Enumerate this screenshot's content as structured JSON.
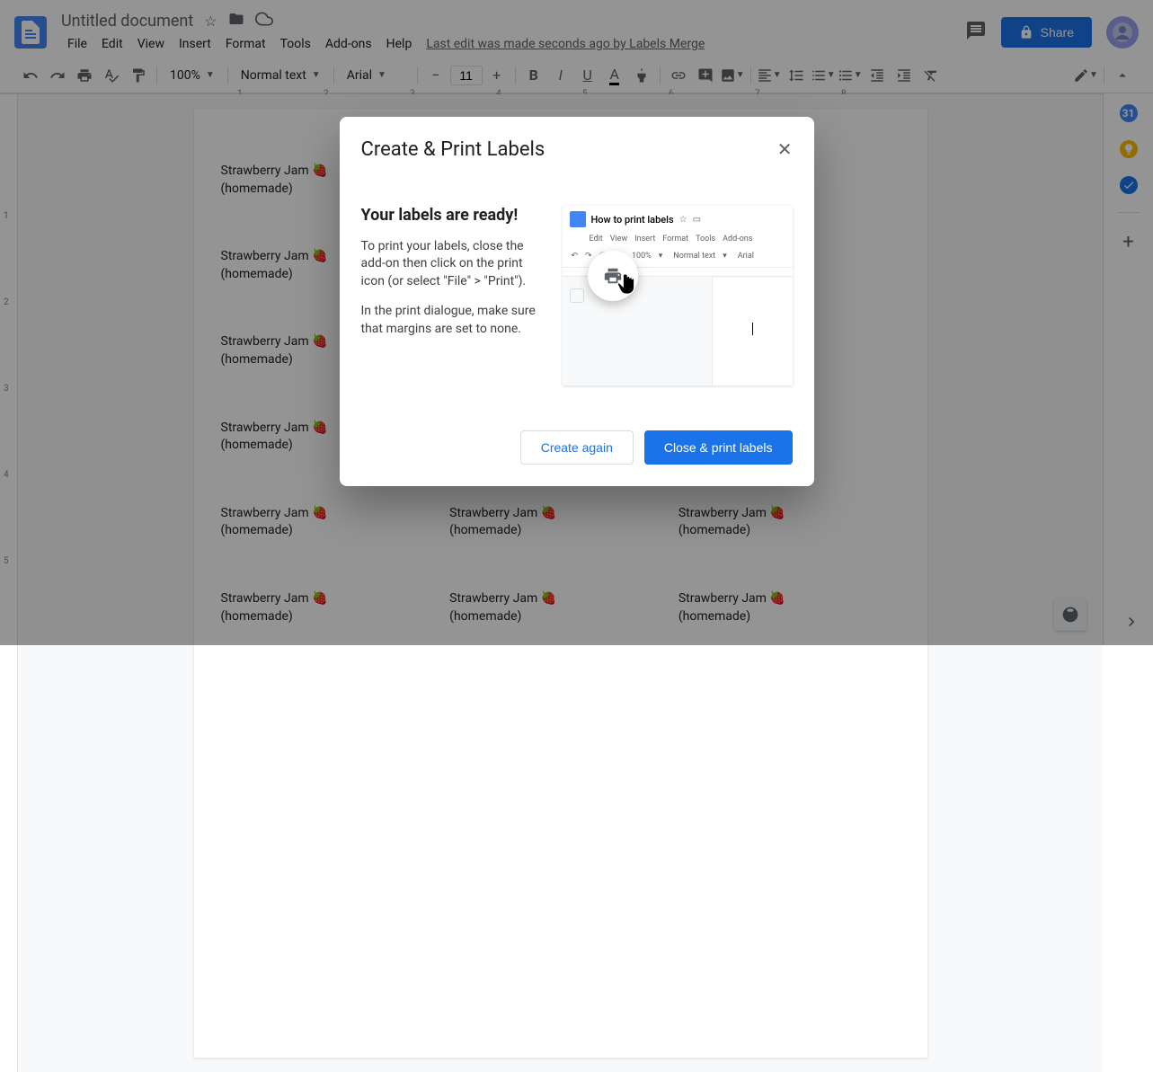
{
  "doc": {
    "title": "Untitled document",
    "last_edit": "Last edit was made seconds ago by Labels Merge"
  },
  "menubar": [
    "File",
    "Edit",
    "View",
    "Insert",
    "Format",
    "Tools",
    "Add-ons",
    "Help"
  ],
  "toolbar": {
    "zoom": "100%",
    "style": "Normal text",
    "font": "Arial",
    "font_size": "11"
  },
  "share_label": "Share",
  "ruler_marks": [
    "1",
    "2",
    "3",
    "4",
    "5",
    "6",
    "7",
    "8"
  ],
  "ruler_v_marks": [
    "1",
    "2",
    "3",
    "4",
    "5"
  ],
  "label_text": {
    "line1": "Strawberry Jam 🍓",
    "line2": "(homemade)"
  },
  "dialog": {
    "title": "Create & Print Labels",
    "heading": "Your labels are ready!",
    "para1": "To print your labels, close the add-on then click on the print icon (or select \"File\" > \"Print\").",
    "para2": "In the print dialogue, make sure that margins are set to none.",
    "image_title": "How to print labels",
    "create_again": "Create again",
    "close_print": "Close & print labels",
    "mini_menu": [
      "Edit",
      "View",
      "Insert",
      "Format",
      "Tools",
      "Add-ons"
    ],
    "mini_zoom": "100%",
    "mini_style": "Normal text",
    "mini_font": "Arial"
  }
}
